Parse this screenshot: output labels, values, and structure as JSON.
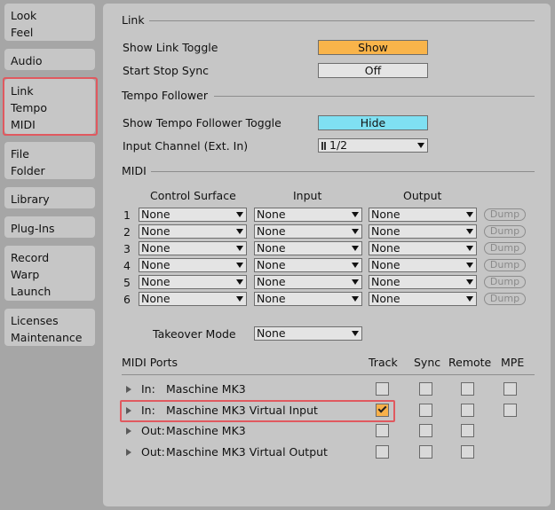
{
  "sidebar": {
    "tabs": [
      {
        "id": "look-feel",
        "lines": [
          "Look",
          "Feel"
        ]
      },
      {
        "id": "audio",
        "lines": [
          "Audio"
        ]
      },
      {
        "id": "link-tempo-midi",
        "lines": [
          "Link",
          "Tempo",
          "MIDI"
        ],
        "selected": true
      },
      {
        "id": "file-folder",
        "lines": [
          "File",
          "Folder"
        ]
      },
      {
        "id": "library",
        "lines": [
          "Library"
        ]
      },
      {
        "id": "plug-ins",
        "lines": [
          "Plug-Ins"
        ]
      },
      {
        "id": "record-warp-launch",
        "lines": [
          "Record",
          "Warp",
          "Launch"
        ]
      },
      {
        "id": "licenses-maintenance",
        "lines": [
          "Licenses",
          "Maintenance"
        ]
      }
    ]
  },
  "link": {
    "heading": "Link",
    "show_link_toggle_label": "Show Link Toggle",
    "show_link_toggle_value": "Show",
    "start_stop_sync_label": "Start Stop Sync",
    "start_stop_sync_value": "Off"
  },
  "tempo_follower": {
    "heading": "Tempo Follower",
    "show_toggle_label": "Show Tempo Follower Toggle",
    "show_toggle_value": "Hide",
    "input_channel_label": "Input Channel (Ext. In)",
    "input_channel_value": "1/2"
  },
  "midi": {
    "heading": "MIDI",
    "col_control_surface": "Control Surface",
    "col_input": "Input",
    "col_output": "Output",
    "rows": [
      {
        "num": "1",
        "surface": "None",
        "input": "None",
        "output": "None",
        "dump": "Dump"
      },
      {
        "num": "2",
        "surface": "None",
        "input": "None",
        "output": "None",
        "dump": "Dump"
      },
      {
        "num": "3",
        "surface": "None",
        "input": "None",
        "output": "None",
        "dump": "Dump"
      },
      {
        "num": "4",
        "surface": "None",
        "input": "None",
        "output": "None",
        "dump": "Dump"
      },
      {
        "num": "5",
        "surface": "None",
        "input": "None",
        "output": "None",
        "dump": "Dump"
      },
      {
        "num": "6",
        "surface": "None",
        "input": "None",
        "output": "None",
        "dump": "Dump"
      }
    ],
    "takeover_label": "Takeover Mode",
    "takeover_value": "None"
  },
  "midi_ports": {
    "heading": "MIDI Ports",
    "col_track": "Track",
    "col_sync": "Sync",
    "col_remote": "Remote",
    "col_mpe": "MPE",
    "ports": [
      {
        "dir": "In:",
        "name": "Maschine MK3",
        "track": false,
        "sync": false,
        "remote": false,
        "mpe": false
      },
      {
        "dir": "In:",
        "name": "Maschine MK3 Virtual Input",
        "track": true,
        "sync": false,
        "remote": false,
        "mpe": false
      },
      {
        "dir": "Out:",
        "name": "Maschine MK3",
        "track": false,
        "sync": false,
        "remote": false,
        "mpe": null
      },
      {
        "dir": "Out:",
        "name": "Maschine MK3 Virtual Output",
        "track": false,
        "sync": false,
        "remote": false,
        "mpe": null
      }
    ]
  },
  "colors": {
    "show_button": "#f9b44a",
    "hide_button": "#7fe0f2",
    "off_button": "#e4e4e4",
    "highlight": "#e0595f",
    "checked": "#f8b14a"
  }
}
